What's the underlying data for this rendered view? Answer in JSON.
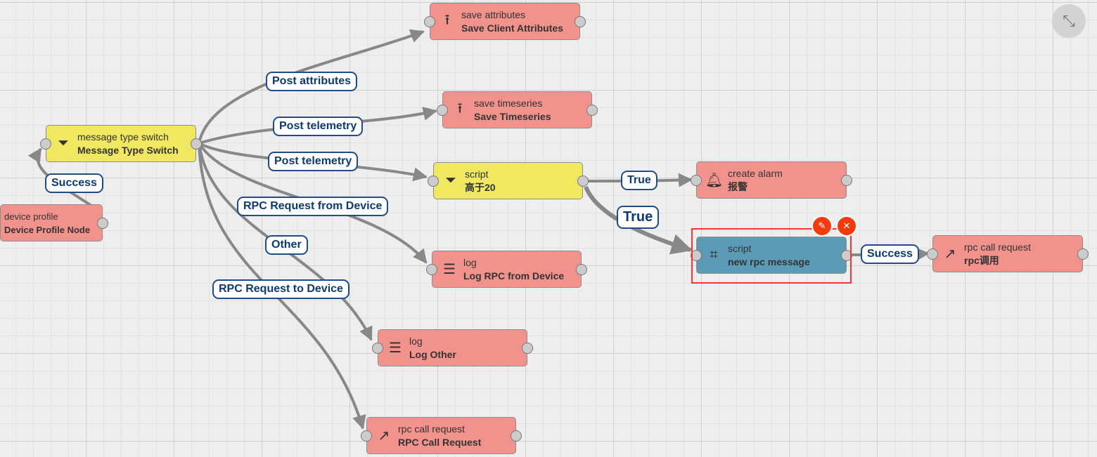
{
  "nodes": {
    "save_attributes": {
      "type": "save attributes",
      "name": "Save Client Attributes",
      "icon": "upload-icon"
    },
    "save_timeseries": {
      "type": "save timeseries",
      "name": "Save Timeseries",
      "icon": "upload-icon"
    },
    "message_type_switch": {
      "type": "message type switch",
      "name": "Message Type Switch",
      "icon": "filter-icon"
    },
    "script_filter": {
      "type": "script",
      "name": "高于20",
      "icon": "filter-icon"
    },
    "create_alarm": {
      "type": "create alarm",
      "name": "报警",
      "icon": "bell-icon"
    },
    "device_profile": {
      "type": "device profile",
      "name": "Device Profile Node",
      "icon": "profile-icon"
    },
    "script_transform": {
      "type": "script",
      "name": "new rpc message",
      "icon": "crop-icon"
    },
    "rpc_call_request_2": {
      "type": "rpc call request",
      "name": "rpc调用",
      "icon": "arrow-up-right-icon"
    },
    "log_rpc": {
      "type": "log",
      "name": "Log RPC from Device",
      "icon": "menu-icon"
    },
    "log_other": {
      "type": "log",
      "name": "Log Other",
      "icon": "menu-icon"
    },
    "rpc_call_request": {
      "type": "rpc call request",
      "name": "RPC Call Request",
      "icon": "arrow-up-right-icon"
    }
  },
  "edge_labels": {
    "post_attributes": "Post attributes",
    "post_telemetry_1": "Post telemetry",
    "post_telemetry_2": "Post telemetry",
    "rpc_from_device": "RPC Request from Device",
    "other": "Other",
    "rpc_to_device": "RPC Request to Device",
    "success_profile": "Success",
    "true_alarm": "True",
    "true_script": "True",
    "success_rpc": "Success"
  },
  "colors": {
    "filter_node": "#f1e861",
    "action_node": "#f2928c",
    "transform_node": "#5b9bb5",
    "label_border": "#1f4b86",
    "selection": "#ff3333",
    "action_button": "#f43b0c"
  },
  "toolbar": {
    "fullscreen_exit_icon": "fullscreen-exit-icon"
  }
}
